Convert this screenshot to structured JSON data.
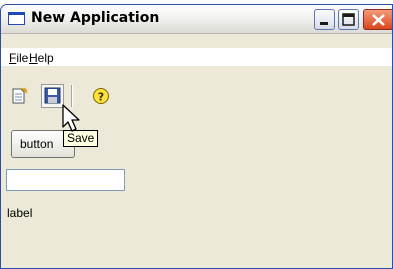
{
  "window": {
    "title": "New Application",
    "icon": "window-icon",
    "controls": [
      "minimize-icon",
      "maximize-icon",
      "close-icon"
    ]
  },
  "menubar": {
    "items": [
      {
        "mnemonic": "F",
        "rest": "ile"
      },
      {
        "mnemonic": "H",
        "rest": "elp"
      }
    ]
  },
  "toolbar": {
    "items": [
      "new-file-icon",
      "save-icon",
      "help-icon"
    ],
    "hovered": "save-icon"
  },
  "content": {
    "button_label": "button",
    "text_field_value": "",
    "label_text": "label"
  },
  "tooltip": {
    "text": "Save"
  },
  "colors": {
    "frame_blue": "#2b4fa8",
    "close_red": "#d9471c",
    "tooltip_bg": "#ffffe1",
    "window_bg": "#ece9d8"
  }
}
